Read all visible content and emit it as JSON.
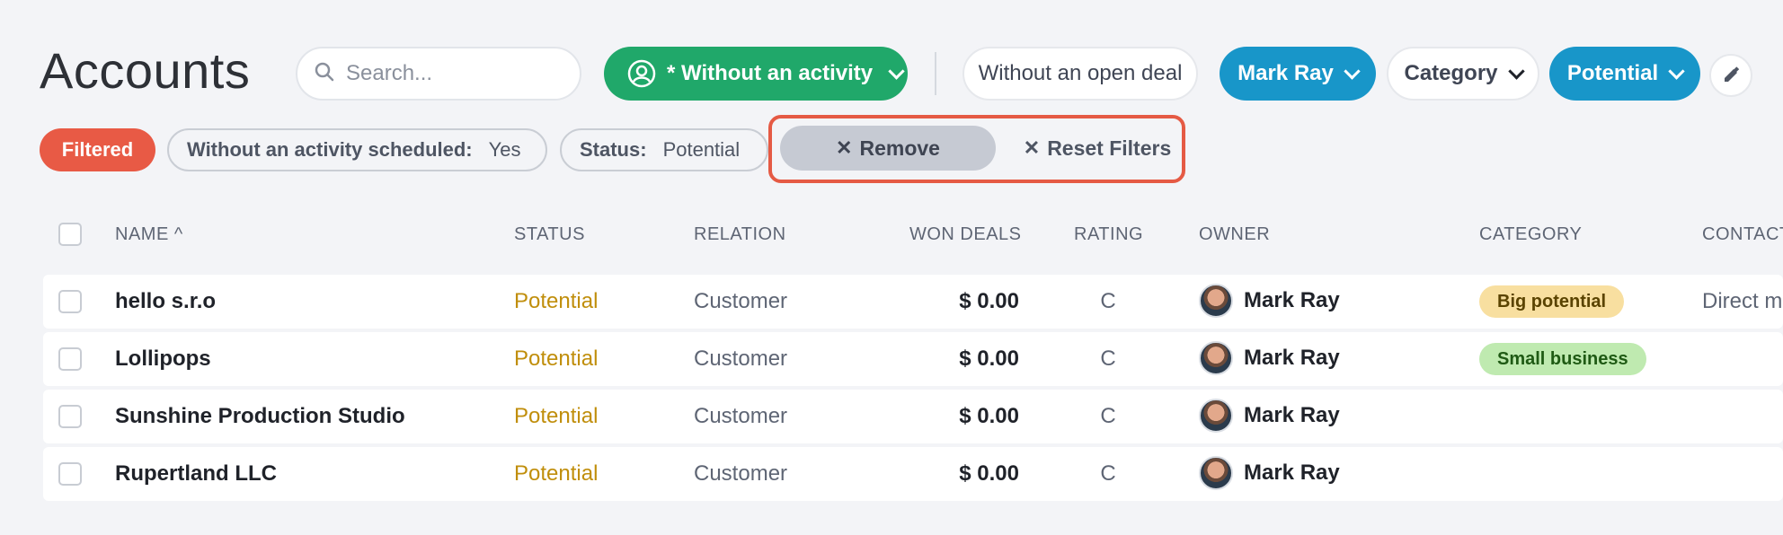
{
  "header": {
    "title": "Accounts",
    "search_placeholder": "Search...",
    "activity_filter": "* Without an activity",
    "open_deal_filter": "Without an open deal",
    "owner_filter": "Mark Ray",
    "category_filter": "Category",
    "status_filter": "Potential"
  },
  "filters": {
    "badge": "Filtered",
    "chips": [
      {
        "key": "Without an activity scheduled:",
        "value": "Yes"
      },
      {
        "key": "Status:",
        "value": "Potential"
      }
    ],
    "remove_label": "Remove",
    "reset_label": "Reset Filters",
    "x_glyph": "✕"
  },
  "table": {
    "columns": [
      "NAME ^",
      "STATUS",
      "RELATION",
      "WON DEALS",
      "RATING",
      "OWNER",
      "CATEGORY",
      "CONTACT"
    ],
    "rows": [
      {
        "name": "hello s.r.o",
        "status": "Potential",
        "relation": "Customer",
        "won_deals": "$ 0.00",
        "rating": "C",
        "owner": "Mark Ray",
        "category": "Big potential",
        "contact": "Direct m"
      },
      {
        "name": "Lollipops",
        "status": "Potential",
        "relation": "Customer",
        "won_deals": "$ 0.00",
        "rating": "C",
        "owner": "Mark Ray",
        "category": "Small business",
        "contact": ""
      },
      {
        "name": "Sunshine Production Studio",
        "status": "Potential",
        "relation": "Customer",
        "won_deals": "$ 0.00",
        "rating": "C",
        "owner": "Mark Ray",
        "category": "",
        "contact": ""
      },
      {
        "name": "Rupertland LLC",
        "status": "Potential",
        "relation": "Customer",
        "won_deals": "$ 0.00",
        "rating": "C",
        "owner": "Mark Ray",
        "category": "",
        "contact": ""
      }
    ]
  },
  "colors": {
    "green": "#20a86a",
    "blue": "#1896c9",
    "filtered_red": "#e85a45",
    "status_gold": "#c08e0b",
    "tag_big_potential_bg": "#f8dfa0",
    "tag_small_business_bg": "#bfeab0"
  },
  "icons": [
    "search-icon",
    "user-circle-icon",
    "chevron-down-icon",
    "pencil-icon",
    "close-icon",
    "sort-up-icon"
  ]
}
